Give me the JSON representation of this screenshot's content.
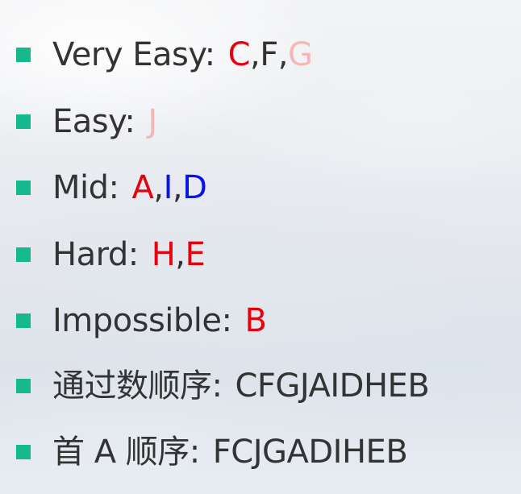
{
  "colors": {
    "bullet": "#16b98d",
    "text": "#333333",
    "red": "#e8000f",
    "pink": "#f5b8b8",
    "blue": "#0a14e6"
  },
  "items": [
    {
      "label": "Very Easy:",
      "parts": [
        {
          "text": "C",
          "color": "#e8000f"
        },
        {
          "text": ",",
          "color": "#333333"
        },
        {
          "text": "F",
          "color": "#333333"
        },
        {
          "text": ",",
          "color": "#333333"
        },
        {
          "text": "G",
          "color": "#f5b8b8"
        }
      ]
    },
    {
      "label": "Easy:",
      "parts": [
        {
          "text": "J",
          "color": "#f5b8b8"
        }
      ]
    },
    {
      "label": "Mid:",
      "parts": [
        {
          "text": "A",
          "color": "#e8000f"
        },
        {
          "text": ",",
          "color": "#333333"
        },
        {
          "text": "I",
          "color": "#0a14e6"
        },
        {
          "text": ",",
          "color": "#333333"
        },
        {
          "text": "D",
          "color": "#0a14e6"
        }
      ]
    },
    {
      "label": "Hard:",
      "parts": [
        {
          "text": "H",
          "color": "#e8000f"
        },
        {
          "text": ",",
          "color": "#333333"
        },
        {
          "text": "E",
          "color": "#e8000f"
        }
      ]
    },
    {
      "label": "Impossible:",
      "parts": [
        {
          "text": "B",
          "color": "#e8000f"
        }
      ]
    },
    {
      "label": "通过数顺序:",
      "parts": [
        {
          "text": "CFGJAIDHEB",
          "color": "#333333"
        }
      ]
    },
    {
      "label": "首 A 顺序:",
      "parts": [
        {
          "text": "FCJGADIHEB",
          "color": "#333333"
        }
      ]
    }
  ]
}
